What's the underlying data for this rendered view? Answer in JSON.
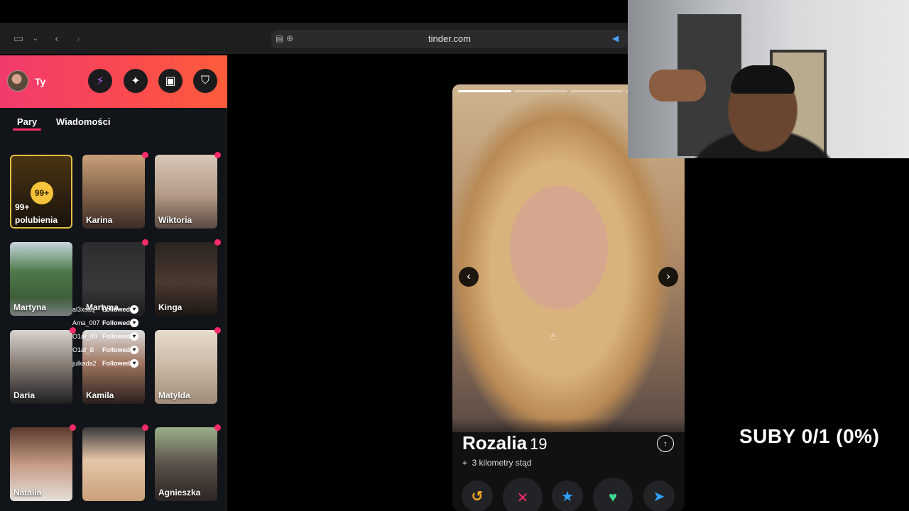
{
  "browser": {
    "url": "tinder.com"
  },
  "sidebar": {
    "user_name": "Ty",
    "tabs": [
      {
        "label": "Pary"
      },
      {
        "label": "Wiadomości"
      }
    ],
    "likes_card": {
      "badge": "99+",
      "line1": "99+",
      "line2": "polubienia"
    },
    "matches": [
      {
        "name": "Karina"
      },
      {
        "name": "Wiktoria"
      },
      {
        "name": "Martyna"
      },
      {
        "name": "Martyna"
      },
      {
        "name": "Kinga"
      },
      {
        "name": "Daria"
      },
      {
        "name": "Kamila"
      },
      {
        "name": "Matylda"
      },
      {
        "name": "Natalia"
      },
      {
        "name": "Agnieszka"
      }
    ]
  },
  "follow_overlay": [
    {
      "user": "al3xsaq",
      "label": "Followed"
    },
    {
      "user": "Ama_007",
      "label": "Followed"
    },
    {
      "user": "O1af_00",
      "label": "Followed"
    },
    {
      "user": "O1af_B",
      "label": "Followed"
    },
    {
      "user": "julkada2",
      "label": "Followed"
    }
  ],
  "profile": {
    "name": "Rozalia",
    "age": "19",
    "distance": "3 kilometry stąd",
    "photos_total": 4,
    "photo_current": 1
  },
  "actions": {
    "rewind": "↺",
    "nope": "✕",
    "superlike": "★",
    "like": "♥",
    "boost": "➤"
  },
  "stream_overlay": {
    "subs_text": "SUBY 0/1 (0%)"
  },
  "colors": {
    "brand_gradient_start": "#f23a6e",
    "brand_gradient_end": "#fd5d3a",
    "accent": "#fe2a6a",
    "likes_gold": "#f7c33c"
  }
}
